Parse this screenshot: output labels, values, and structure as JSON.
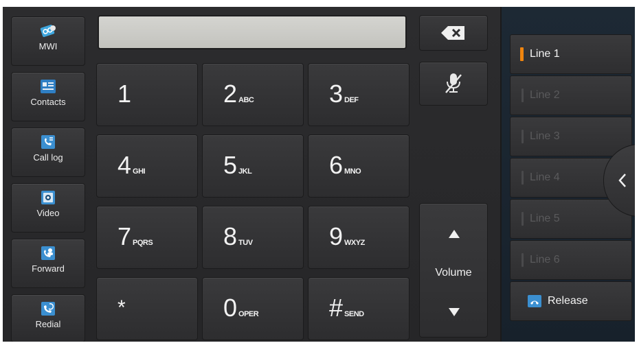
{
  "sidebar": {
    "items": [
      {
        "label": "MWI",
        "icon": "voicemail-icon"
      },
      {
        "label": "Contacts",
        "icon": "contacts-icon"
      },
      {
        "label": "Call log",
        "icon": "call-log-icon"
      },
      {
        "label": "Video",
        "icon": "video-icon"
      },
      {
        "label": "Forward",
        "icon": "forward-icon"
      },
      {
        "label": "Redial",
        "icon": "redial-icon"
      }
    ]
  },
  "display": {
    "value": ""
  },
  "keypad": {
    "keys": [
      {
        "main": "1",
        "sub": ""
      },
      {
        "main": "2",
        "sub": "ABC"
      },
      {
        "main": "3",
        "sub": "DEF"
      },
      {
        "main": "4",
        "sub": "GHI"
      },
      {
        "main": "5",
        "sub": "JKL"
      },
      {
        "main": "6",
        "sub": "MNO"
      },
      {
        "main": "7",
        "sub": "PQRS"
      },
      {
        "main": "8",
        "sub": "TUV"
      },
      {
        "main": "9",
        "sub": "WXYZ"
      },
      {
        "main": "*",
        "sub": ""
      },
      {
        "main": "0",
        "sub": "OPER"
      },
      {
        "main": "#",
        "sub": "SEND"
      }
    ]
  },
  "controls": {
    "backspace_icon": "backspace-icon",
    "mute_icon": "mic-mute-icon",
    "volume_label": "Volume",
    "volume_up_icon": "volume-up-icon",
    "volume_down_icon": "volume-down-icon"
  },
  "lines": {
    "items": [
      {
        "label": "Line 1",
        "active": true
      },
      {
        "label": "Line 2",
        "active": false
      },
      {
        "label": "Line 3",
        "active": false
      },
      {
        "label": "Line 4",
        "active": false
      },
      {
        "label": "Line 5",
        "active": false
      },
      {
        "label": "Line 6",
        "active": false
      }
    ],
    "release_label": "Release",
    "collapse_icon": "chevron-left-icon"
  },
  "colors": {
    "active_line_indicator": "#f0850f",
    "panel_bg": "#2c2c2e",
    "lines_bg": "#1d2934",
    "display_bg": "#cbcbc7"
  }
}
